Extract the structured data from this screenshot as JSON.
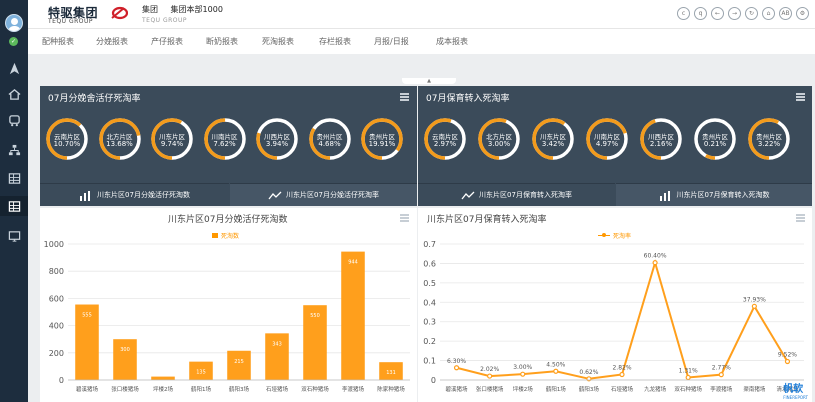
{
  "header": {
    "logo_cn": "特驱集团",
    "logo_en": "TEQU GROUP",
    "org": "集团",
    "dept": "集团本部1000",
    "org_en": "TEQU GROUP",
    "tools": [
      "c",
      "q",
      "←",
      "→",
      "↻",
      "⌂",
      "AB",
      "⚙"
    ]
  },
  "tabs": [
    "配种报表",
    "分娩报表",
    "产仔报表",
    "断奶报表",
    "死淘报表",
    "存栏报表",
    "月报/日报",
    "成本报表"
  ],
  "collapse_label": "▲",
  "left_panel": {
    "title": "07月分娩舍活仔死淘率",
    "gauges": [
      {
        "name": "云南片区",
        "value": "10.70%",
        "pct": 0.62
      },
      {
        "name": "北方片区",
        "value": "13.68%",
        "pct": 0.72
      },
      {
        "name": "川东片区",
        "value": "9.74%",
        "pct": 0.58
      },
      {
        "name": "川南片区",
        "value": "7.62%",
        "pct": 0.5
      },
      {
        "name": "川西片区",
        "value": "3.94%",
        "pct": 0.3
      },
      {
        "name": "贵州片区",
        "value": "4.68%",
        "pct": 0.34
      },
      {
        "name": "贵州片区",
        "value": "19.91%",
        "pct": 0.85
      }
    ],
    "subtabs": [
      "川东片区07月分娩活仔死淘数",
      "川东片区07月分娩活仔死淘率"
    ]
  },
  "right_panel": {
    "title": "07月保育转入死淘率",
    "gauges": [
      {
        "name": "云南片区",
        "value": "2.97%",
        "pct": 0.55
      },
      {
        "name": "北方片区",
        "value": "3.00%",
        "pct": 0.56
      },
      {
        "name": "川东片区",
        "value": "3.42%",
        "pct": 0.6
      },
      {
        "name": "川南片区",
        "value": "4.97%",
        "pct": 0.7
      },
      {
        "name": "川西片区",
        "value": "2.16%",
        "pct": 0.45
      },
      {
        "name": "贵州片区",
        "value": "0.21%",
        "pct": 0.08
      },
      {
        "name": "贵州片区",
        "value": "3.22%",
        "pct": 0.58
      }
    ],
    "subtabs": [
      "川东片区07月保育转入死淘率",
      "川东片区07月保育转入死淘数"
    ]
  },
  "chart_data": [
    {
      "type": "bar",
      "title": "川东片区07月分娩活仔死淘数",
      "legend": "死淘数",
      "categories": [
        "碧溪猪场",
        "张口楼猪场",
        "坪楼2场",
        "鹤阳1场",
        "鹤阳3场",
        "石垭猪场",
        "双石种猪场",
        "李渡猪场",
        "陈家种猪场"
      ],
      "values": [
        555,
        300,
        25,
        135,
        215,
        343,
        550,
        944,
        131
      ],
      "value_labels": [
        "555",
        "300",
        "25",
        "135",
        "215",
        "343",
        "550",
        "944",
        "131"
      ],
      "ylim": [
        0,
        1000
      ],
      "yticks": [
        "0",
        "200",
        "400",
        "600",
        "800",
        "1000"
      ],
      "color": "#ff9f1c"
    },
    {
      "type": "line",
      "title": "川东片区07月保育转入死淘率",
      "legend": "死淘率",
      "categories": [
        "碧溪猪场",
        "张口楼猪场",
        "坪楼2场",
        "鹤阳1场",
        "鹤阳3场",
        "石垭猪场",
        "九龙猪场",
        "双石种猪场",
        "李渡猪场",
        "渠南猪场",
        "清水猪场"
      ],
      "values": [
        0.063,
        0.0202,
        0.03,
        0.045,
        0.0062,
        0.0282,
        0.604,
        0.0131,
        0.0277,
        0.3793,
        0.0952
      ],
      "value_labels": [
        "6.30%",
        "2.02%",
        "3.00%",
        "4.50%",
        "0.62%",
        "2.82%",
        "60.40%",
        "1.31%",
        "2.77%",
        "37.93%",
        "9.52%"
      ],
      "ylim": [
        0,
        0.7
      ],
      "yticks": [
        "0",
        "0.1",
        "0.2",
        "0.3",
        "0.4",
        "0.5",
        "0.6",
        "0.7"
      ],
      "color": "#ff9f1c"
    }
  ],
  "watermark": "帆软",
  "watermark_sub": "FINEREPORT"
}
